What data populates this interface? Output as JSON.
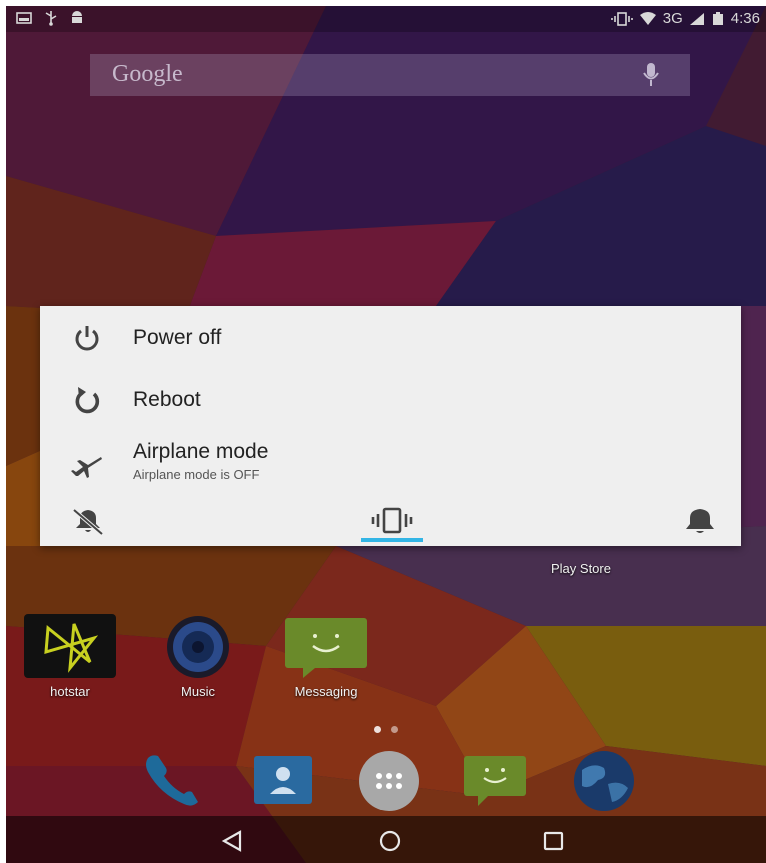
{
  "status_bar": {
    "left_icons": [
      "screenshot-icon",
      "usb-icon",
      "android-debug-icon"
    ],
    "network": "3G",
    "time": "4:36"
  },
  "search": {
    "logo": "Google",
    "mic_icon": "mic-icon"
  },
  "power_menu": {
    "items": [
      {
        "icon": "power-icon",
        "label": "Power off"
      },
      {
        "icon": "reboot-icon",
        "label": "Reboot"
      },
      {
        "icon": "airplane-icon",
        "label": "Airplane mode",
        "sublabel": "Airplane mode is OFF"
      }
    ],
    "ringer_modes": [
      "silent",
      "vibrate",
      "sound"
    ],
    "selected_mode": "vibrate",
    "accent_color": "#33b5e5"
  },
  "home": {
    "play_store_label": "Play Store",
    "apps": [
      {
        "label": "hotstar"
      },
      {
        "label": "Music"
      },
      {
        "label": "Messaging"
      }
    ],
    "dock": [
      "phone-icon",
      "contacts-icon",
      "app-drawer-icon",
      "messaging-icon",
      "browser-icon"
    ]
  },
  "nav": [
    "back-icon",
    "home-icon",
    "recents-icon"
  ]
}
